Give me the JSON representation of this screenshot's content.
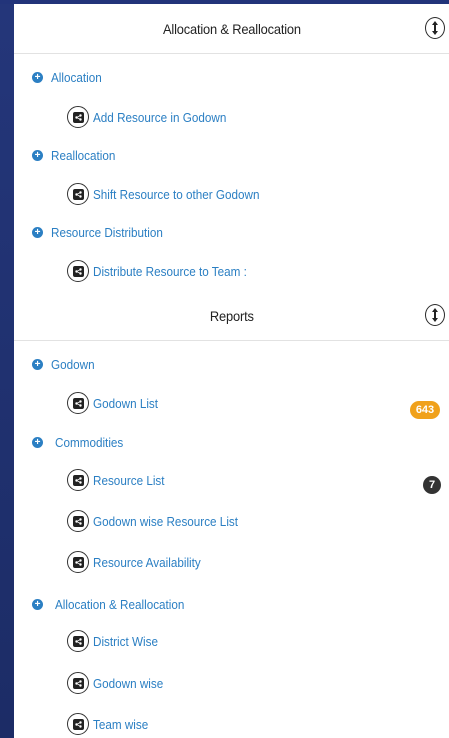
{
  "section1": {
    "title": "Allocation & Reallocation",
    "groups": [
      {
        "label": "Allocation",
        "items": [
          "Add Resource in Godown"
        ]
      },
      {
        "label": "Reallocation",
        "items": [
          "Shift Resource to other Godown"
        ]
      },
      {
        "label": "Resource Distribution",
        "items": [
          "Distribute Resource to Team :"
        ]
      }
    ]
  },
  "section2": {
    "title": "Reports",
    "groups": [
      {
        "label": "Godown",
        "items": [
          {
            "label": "Godown List",
            "badge": "643"
          }
        ]
      },
      {
        "label": "Commodities",
        "items": [
          {
            "label": "Resource List",
            "badge": "7"
          },
          {
            "label": "Godown wise Resource List"
          },
          {
            "label": "Resource Availability"
          }
        ]
      },
      {
        "label": "Allocation & Reallocation",
        "items": [
          {
            "label": "District Wise"
          },
          {
            "label": "Godown wise"
          },
          {
            "label": "Team wise"
          }
        ]
      }
    ]
  },
  "colors": {
    "link": "#2b7fc3",
    "badge_orange": "#f0a11b",
    "badge_dark": "#333333",
    "sidebar_bg": "#1a2a5e"
  },
  "icons": {
    "expand": "plus-circle-icon",
    "item": "share-square-icon",
    "toggle": "vertical-arrows-icon"
  }
}
